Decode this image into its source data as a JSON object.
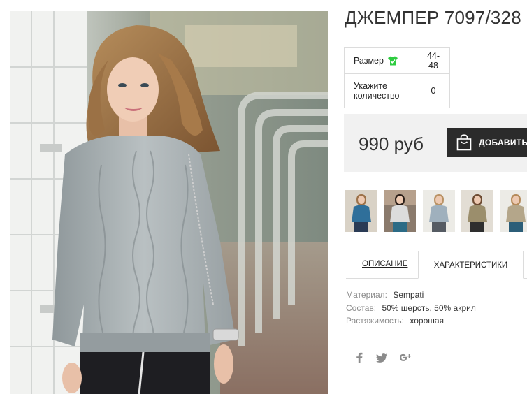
{
  "product": {
    "title": "ДЖЕМПЕР 7097/328",
    "price": "990 руб",
    "add_to_cart_label": "ДОБАВИТЬ"
  },
  "options": {
    "size_label": "Размер",
    "size_value": "44-48",
    "qty_label_line1": "Укажите",
    "qty_label_line2": "количество",
    "qty_value": "0"
  },
  "tabs": {
    "description": "ОПИСАНИЕ",
    "characteristics": "ХАРАКТЕРИСТИКИ"
  },
  "specs": [
    {
      "label": "Материал:",
      "value": "Sempati"
    },
    {
      "label": "Состав:",
      "value": "50% шерсть, 50% акрил"
    },
    {
      "label": "Растяжимость:",
      "value": "хорошая"
    }
  ],
  "thumbnails": [
    {
      "color": "#2f6f9a",
      "bg": "#d9d2c6"
    },
    {
      "color": "#dcdcdc",
      "bg": "#8a7a6c"
    },
    {
      "color": "#9fb0bd",
      "bg": "#ecebe6"
    },
    {
      "color": "#9b8e6c",
      "bg": "#e2ddd4"
    },
    {
      "color": "#b4a68a",
      "bg": "#ecebe6"
    }
  ],
  "social": [
    "facebook-icon",
    "twitter-icon",
    "google-plus-icon"
  ],
  "colors": {
    "accent_green": "#2ecc40",
    "button_dark": "#2b2b2b",
    "price_bg": "#f1f1f1"
  }
}
